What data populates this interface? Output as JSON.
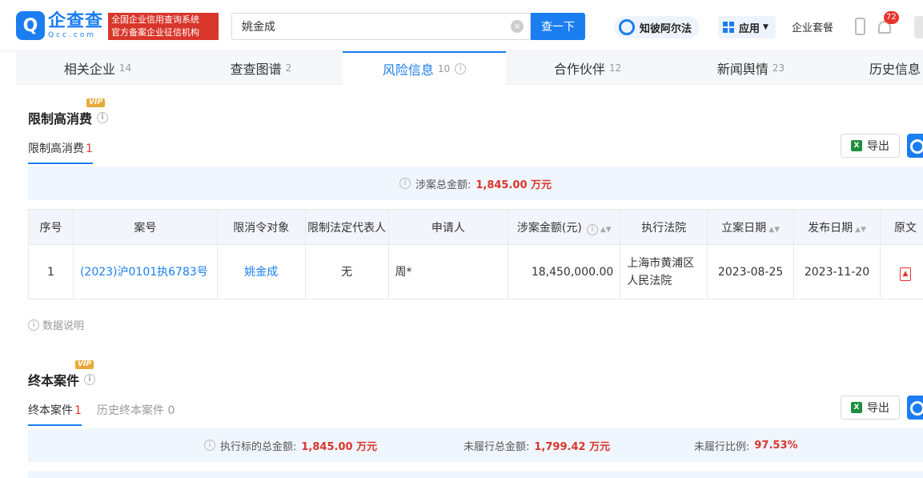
{
  "header": {
    "logo_cn": "企查查",
    "logo_en": "Qcc.com",
    "badge_line1": "全国企业信用查询系统",
    "badge_line2": "官方备案企业征信机构",
    "search_value": "姚金成",
    "search_button": "查一下",
    "zhibi_label": "知彼阿尔法",
    "apps_label": "应用",
    "package_label": "企业套餐",
    "notification_count": "72"
  },
  "tabs": [
    {
      "label": "相关企业",
      "count": "14"
    },
    {
      "label": "查查图谱",
      "count": "2"
    },
    {
      "label": "风险信息",
      "count": "10"
    },
    {
      "label": "合作伙伴",
      "count": "12"
    },
    {
      "label": "新闻舆情",
      "count": "23"
    },
    {
      "label": "历史信息",
      "count": ""
    }
  ],
  "section1": {
    "vip": "VIP",
    "title": "限制高消费",
    "subtab_label": "限制高消费",
    "subtab_count": "1",
    "export_label": "导出",
    "summary_label": "涉案总金额:",
    "summary_value": "1,845.00 万元",
    "table": {
      "headers": [
        "序号",
        "案号",
        "限消令对象",
        "限制法定代表人",
        "申请人",
        "涉案金额(元)",
        "执行法院",
        "立案日期",
        "发布日期",
        "原文"
      ],
      "rows": [
        {
          "index": "1",
          "case_no": "(2023)沪0101执6783号",
          "target": "姚金成",
          "legal_rep": "无",
          "applicant": "周*",
          "amount": "18,450,000.00",
          "court": "上海市黄浦区人民法院",
          "filed_date": "2023-08-25",
          "publish_date": "2023-11-20"
        }
      ]
    },
    "data_note": "数据说明"
  },
  "section2": {
    "vip": "VIP",
    "title": "终本案件",
    "subtab_active_label": "终本案件",
    "subtab_active_count": "1",
    "subtab_history_label": "历史终本案件",
    "subtab_history_count": "0",
    "export_label": "导出",
    "exec_total_label": "执行标的总金额:",
    "exec_total_value": "1,845.00 万元",
    "unpaid_total_label": "未履行总金额:",
    "unpaid_total_value": "1,799.42 万元",
    "unpaid_ratio_label": "未履行比例:",
    "unpaid_ratio_value": "97.53%"
  },
  "colors": {
    "brand": "#1a7ef0",
    "danger": "#d9362b",
    "vip": "#e8a93a"
  }
}
